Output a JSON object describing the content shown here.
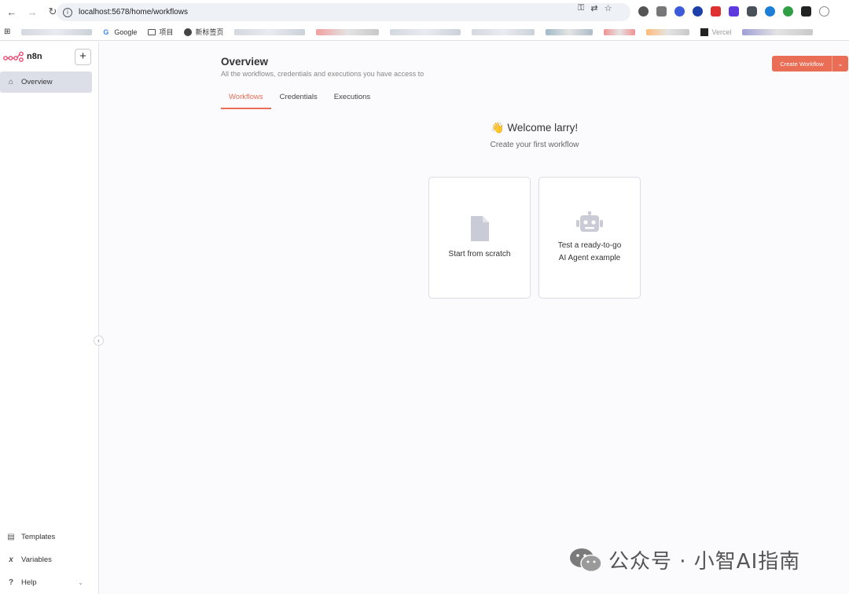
{
  "browser": {
    "url": "localhost:5678/home/workflows",
    "bookmarks": [
      "Google",
      "项目",
      "新标签页",
      "Vercel"
    ]
  },
  "sidebar": {
    "brand": "n8n",
    "items": [
      {
        "label": "Overview",
        "icon": "home-icon"
      }
    ],
    "bottom_items": [
      {
        "label": "Templates",
        "icon": "templates-icon"
      },
      {
        "label": "Variables",
        "icon": "variables-icon"
      },
      {
        "label": "Help",
        "icon": "help-icon"
      }
    ]
  },
  "header": {
    "title": "Overview",
    "subtitle": "All the workflows, credentials and executions you have access to",
    "create_label": "Create Workflow"
  },
  "tabs": [
    {
      "label": "Workflows",
      "active": true
    },
    {
      "label": "Credentials",
      "active": false
    },
    {
      "label": "Executions",
      "active": false
    }
  ],
  "welcome": {
    "title": "👋 Welcome larry!",
    "subtitle": "Create your first workflow"
  },
  "cards": [
    {
      "label": "Start from scratch",
      "icon": "file-icon"
    },
    {
      "label_line1": "Test a ready-to-go",
      "label_line2": "AI Agent example",
      "icon": "robot-icon"
    }
  ],
  "watermark": "公众号 · 小智AI指南",
  "colors": {
    "accent": "#ea6d56",
    "brand": "#ea4b71"
  }
}
